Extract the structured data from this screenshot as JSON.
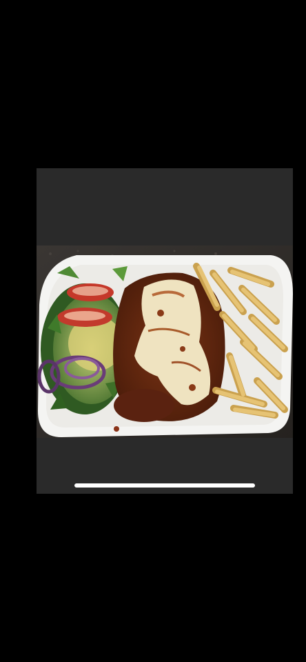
{
  "viewer": {
    "background": "#2a2a2a",
    "image_subject": "plate-of-food"
  },
  "colors": {
    "screen_background": "#000000",
    "home_indicator": "#ffffff"
  }
}
